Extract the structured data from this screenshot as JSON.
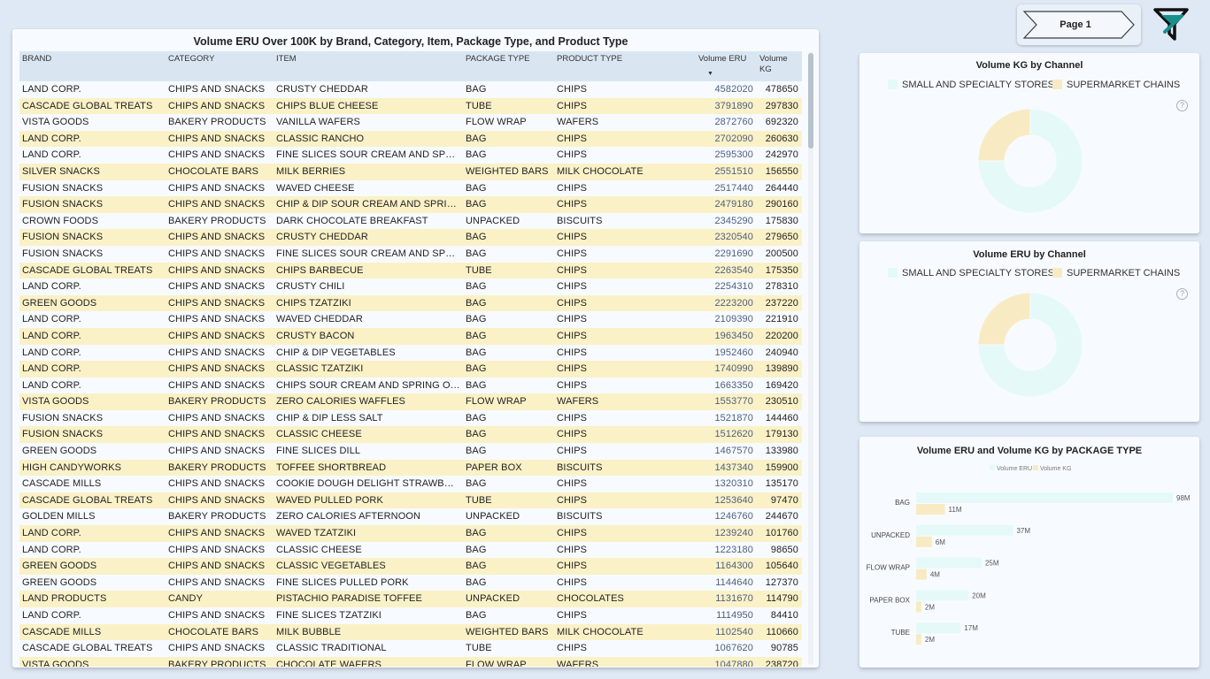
{
  "table": {
    "title": "Volume ERU Over 100K by Brand, Category, Item, Package Type, and Product Type",
    "columns": [
      "BRAND",
      "CATEGORY",
      "ITEM",
      "PACKAGE TYPE",
      "PRODUCT TYPE",
      "Volume ERU",
      "Volume KG"
    ],
    "sort_indicator": "▼",
    "rows": [
      [
        "LAND CORP.",
        "CHIPS AND SNACKS",
        "CRUSTY CHEDDAR",
        "BAG",
        "CHIPS",
        "4582020",
        "478650"
      ],
      [
        "CASCADE GLOBAL TREATS",
        "CHIPS AND SNACKS",
        "CHIPS BLUE CHEESE",
        "TUBE",
        "CHIPS",
        "3791890",
        "297830"
      ],
      [
        "VISTA GOODS",
        "BAKERY PRODUCTS",
        "VANILLA WAFERS",
        "FLOW WRAP",
        "WAFERS",
        "2872760",
        "692320"
      ],
      [
        "LAND CORP.",
        "CHIPS AND SNACKS",
        "CLASSIC RANCHO",
        "BAG",
        "CHIPS",
        "2702090",
        "260630"
      ],
      [
        "LAND CORP.",
        "CHIPS AND SNACKS",
        "FINE SLICES SOUR CREAM AND SPRING ONION",
        "BAG",
        "CHIPS",
        "2595300",
        "242970"
      ],
      [
        "SILVER SNACKS",
        "CHOCOLATE BARS",
        "MILK BERRIES",
        "WEIGHTED BARS",
        "MILK CHOCOLATE",
        "2551510",
        "156550"
      ],
      [
        "FUSION SNACKS",
        "CHIPS AND SNACKS",
        "WAVED CHEESE",
        "BAG",
        "CHIPS",
        "2517440",
        "264440"
      ],
      [
        "FUSION SNACKS",
        "CHIPS AND SNACKS",
        "CHIP & DIP SOUR CREAM AND SPRING ONION",
        "BAG",
        "CHIPS",
        "2479180",
        "290160"
      ],
      [
        "CROWN FOODS",
        "BAKERY PRODUCTS",
        "DARK CHOCOLATE BREAKFAST",
        "UNPACKED",
        "BISCUITS",
        "2345290",
        "175830"
      ],
      [
        "FUSION SNACKS",
        "CHIPS AND SNACKS",
        "CRUSTY CHEDDAR",
        "BAG",
        "CHIPS",
        "2320540",
        "279650"
      ],
      [
        "FUSION SNACKS",
        "CHIPS AND SNACKS",
        "FINE SLICES SOUR CREAM AND SPRING ONION",
        "BAG",
        "CHIPS",
        "2291690",
        "200500"
      ],
      [
        "CASCADE GLOBAL TREATS",
        "CHIPS AND SNACKS",
        "CHIPS BARBECUE",
        "TUBE",
        "CHIPS",
        "2263540",
        "175350"
      ],
      [
        "LAND CORP.",
        "CHIPS AND SNACKS",
        "CRUSTY CHILI",
        "BAG",
        "CHIPS",
        "2254310",
        "278310"
      ],
      [
        "GREEN GOODS",
        "CHIPS AND SNACKS",
        "CHIPS TZATZIKI",
        "BAG",
        "CHIPS",
        "2223200",
        "237220"
      ],
      [
        "LAND CORP.",
        "CHIPS AND SNACKS",
        "WAVED CHEDDAR",
        "BAG",
        "CHIPS",
        "2109390",
        "221910"
      ],
      [
        "LAND CORP.",
        "CHIPS AND SNACKS",
        "CRUSTY BACON",
        "BAG",
        "CHIPS",
        "1963450",
        "220200"
      ],
      [
        "LAND CORP.",
        "CHIPS AND SNACKS",
        "CHIP & DIP VEGETABLES",
        "BAG",
        "CHIPS",
        "1952460",
        "240940"
      ],
      [
        "LAND CORP.",
        "CHIPS AND SNACKS",
        "CLASSIC TZATZIKI",
        "BAG",
        "CHIPS",
        "1740990",
        "139890"
      ],
      [
        "LAND CORP.",
        "CHIPS AND SNACKS",
        "CHIPS SOUR CREAM AND SPRING ONION",
        "BAG",
        "CHIPS",
        "1663350",
        "169420"
      ],
      [
        "VISTA GOODS",
        "BAKERY PRODUCTS",
        "ZERO CALORIES WAFFLES",
        "FLOW WRAP",
        "WAFERS",
        "1553770",
        "230510"
      ],
      [
        "FUSION SNACKS",
        "CHIPS AND SNACKS",
        "CHIP & DIP LESS SALT",
        "BAG",
        "CHIPS",
        "1521870",
        "144460"
      ],
      [
        "FUSION SNACKS",
        "CHIPS AND SNACKS",
        "CLASSIC CHEESE",
        "BAG",
        "CHIPS",
        "1512620",
        "179130"
      ],
      [
        "GREEN GOODS",
        "CHIPS AND SNACKS",
        "FINE SLICES DILL",
        "BAG",
        "CHIPS",
        "1467570",
        "133980"
      ],
      [
        "HIGH CANDYWORKS",
        "BAKERY PRODUCTS",
        "TOFFEE SHORTBREAD",
        "PAPER BOX",
        "BISCUITS",
        "1437340",
        "159900"
      ],
      [
        "CASCADE MILLS",
        "CHIPS AND SNACKS",
        "COOKIE DOUGH DELIGHT STRAWBERRY",
        "BAG",
        "CHIPS",
        "1320310",
        "135170"
      ],
      [
        "CASCADE GLOBAL TREATS",
        "CHIPS AND SNACKS",
        "WAVED PULLED PORK",
        "TUBE",
        "CHIPS",
        "1253640",
        "97470"
      ],
      [
        "GOLDEN MILLS",
        "BAKERY PRODUCTS",
        "ZERO CALORIES AFTERNOON",
        "UNPACKED",
        "BISCUITS",
        "1246760",
        "244670"
      ],
      [
        "LAND CORP.",
        "CHIPS AND SNACKS",
        "WAVED TZATZIKI",
        "BAG",
        "CHIPS",
        "1239240",
        "101760"
      ],
      [
        "LAND CORP.",
        "CHIPS AND SNACKS",
        "CLASSIC CHEESE",
        "BAG",
        "CHIPS",
        "1223180",
        "98650"
      ],
      [
        "GREEN GOODS",
        "CHIPS AND SNACKS",
        "CLASSIC VEGETABLES",
        "BAG",
        "CHIPS",
        "1164300",
        "105640"
      ],
      [
        "GREEN GOODS",
        "CHIPS AND SNACKS",
        "FINE SLICES PULLED PORK",
        "BAG",
        "CHIPS",
        "1144640",
        "127370"
      ],
      [
        "LAND PRODUCTS",
        "CANDY",
        "PISTACHIO PARADISE TOFFEE",
        "UNPACKED",
        "CHOCOLATES",
        "1131670",
        "114790"
      ],
      [
        "LAND CORP.",
        "CHIPS AND SNACKS",
        "FINE SLICES TZATZIKI",
        "BAG",
        "CHIPS",
        "1114950",
        "84410"
      ],
      [
        "CASCADE MILLS",
        "CHOCOLATE BARS",
        "MILK BUBBLE",
        "WEIGHTED BARS",
        "MILK CHOCOLATE",
        "1102540",
        "110660"
      ],
      [
        "CASCADE GLOBAL TREATS",
        "CHIPS AND SNACKS",
        "CLASSIC TRADITIONAL",
        "TUBE",
        "CHIPS",
        "1067620",
        "90785"
      ],
      [
        "VISTA GOODS",
        "BAKERY PRODUCTS",
        "CHOCOLATE WAFERS",
        "FLOW WRAP",
        "WAFERS",
        "1047880",
        "238720"
      ]
    ]
  },
  "navigation": {
    "page_label": "Page 1"
  },
  "donut_kg": {
    "title": "Volume KG by Channel",
    "legend": [
      "SMALL AND SPECIALTY STORES",
      "SUPERMARKET CHAINS"
    ],
    "help": "?"
  },
  "donut_eru": {
    "title": "Volume ERU by Channel",
    "legend": [
      "SMALL AND SPECIALTY STORES",
      "SUPERMARKET CHAINS"
    ],
    "help": "?"
  },
  "bar_chart": {
    "title": "Volume ERU and Volume KG by PACKAGE TYPE",
    "legend": [
      "Volume ERU",
      "Volume KG"
    ]
  },
  "colors": {
    "series_a": "#e5f9f9",
    "series_b": "#f8ebc3",
    "row_alt": "#faf1c7",
    "header_bg": "#d9e6f2",
    "logo": "#1a8f8a"
  },
  "chart_data": [
    {
      "type": "pie",
      "title": "Volume KG by Channel",
      "categories": [
        "SMALL AND SPECIALTY STORES",
        "SUPERMARKET CHAINS"
      ],
      "values": [
        75,
        25
      ],
      "legend": "top-center"
    },
    {
      "type": "pie",
      "title": "Volume ERU by Channel",
      "categories": [
        "SMALL AND SPECIALTY STORES",
        "SUPERMARKET CHAINS"
      ],
      "values": [
        75,
        25
      ],
      "legend": "top-center"
    },
    {
      "type": "bar",
      "orientation": "horizontal",
      "title": "Volume ERU and Volume KG by PACKAGE TYPE",
      "categories": [
        "BAG",
        "UNPACKED",
        "FLOW WRAP",
        "PAPER BOX",
        "TUBE"
      ],
      "series": [
        {
          "name": "Volume ERU",
          "values": [
            98000000,
            37000000,
            25000000,
            20000000,
            17000000
          ],
          "labels": [
            "98M",
            "37M",
            "25M",
            "20M",
            "17M"
          ]
        },
        {
          "name": "Volume KG",
          "values": [
            11000000,
            6000000,
            4000000,
            2000000,
            2000000
          ],
          "labels": [
            "11M",
            "6M",
            "4M",
            "2M",
            "2M"
          ]
        }
      ],
      "xlim": [
        0,
        98000000
      ],
      "legend": "top-center",
      "grid": false
    }
  ]
}
